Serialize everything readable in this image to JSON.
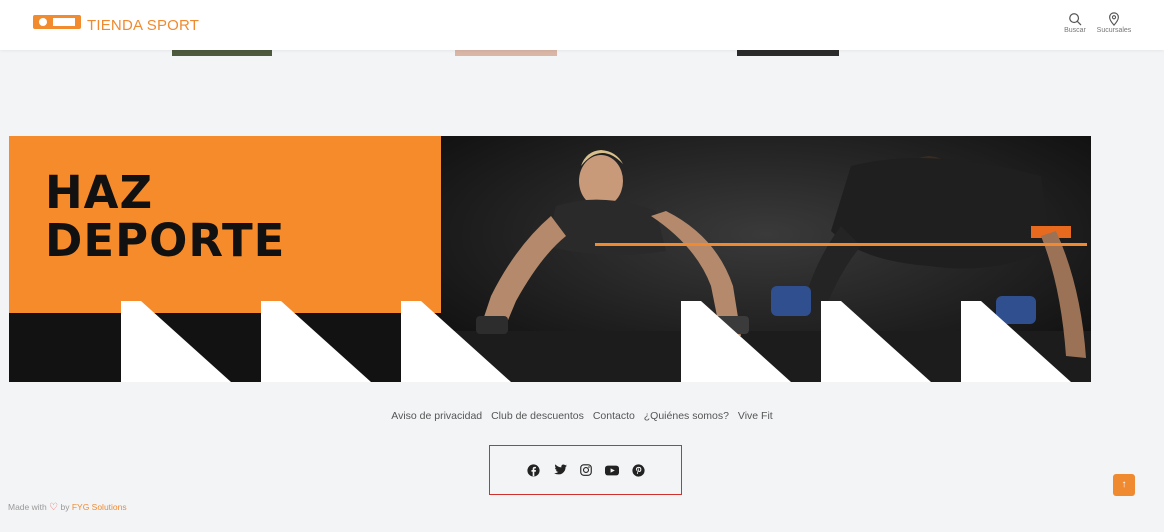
{
  "header": {
    "brand": "TIENDA SPORT",
    "actions": [
      {
        "label": "Buscar",
        "icon": "search-icon"
      },
      {
        "label": "Sucursales",
        "icon": "location-pin-icon"
      }
    ]
  },
  "banner": {
    "line1": "HAZ",
    "line2": "DEPORTE"
  },
  "footer": {
    "links": [
      "Aviso de privacidad",
      "Club de descuentos",
      "Contacto",
      "¿Quiénes somos?",
      "Vive Fit"
    ],
    "social": [
      "facebook-icon",
      "twitter-icon",
      "instagram-icon",
      "youtube-icon",
      "pinterest-icon"
    ],
    "made_with_prefix": "Made with",
    "made_with_by": "by",
    "company": "FYG Solutions"
  },
  "colors": {
    "accent": "#f08a30",
    "banner_orange": "#f68b2b",
    "highlight_border": "#d0312d"
  }
}
